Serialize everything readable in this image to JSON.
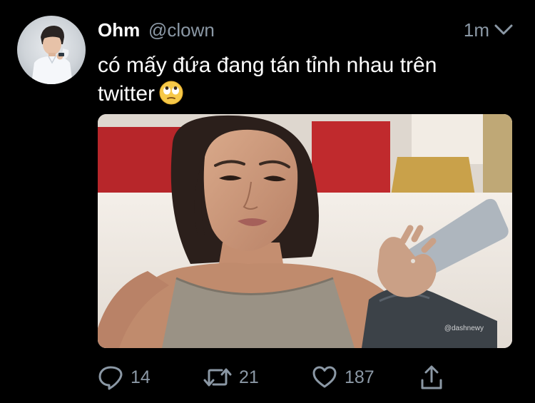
{
  "tweet": {
    "author": {
      "display_name": "Ohm",
      "handle": "@clown"
    },
    "time": "1m",
    "text": "có mấy đứa đang tán tỉnh nhau trên twitter",
    "emoji": "face-with-rolling-eyes",
    "media": {
      "watermark": "@dashnewy"
    },
    "stats": {
      "replies": "14",
      "retweets": "21",
      "likes": "187"
    }
  },
  "icons": {
    "reply": "speech-bubble-icon",
    "retweet": "retweet-arrows-icon",
    "like": "heart-icon",
    "share": "share-upload-icon",
    "menu": "chevron-down-icon"
  },
  "colors": {
    "background": "#000000",
    "text_primary": "#ffffff",
    "text_secondary": "#8b98a5"
  }
}
